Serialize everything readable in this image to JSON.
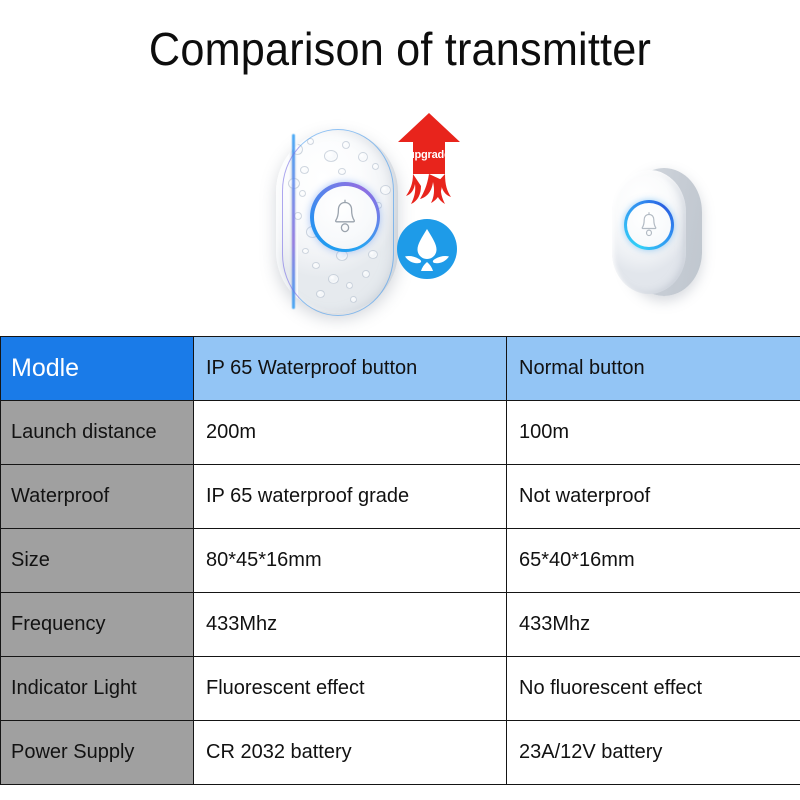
{
  "page": {
    "title": "Comparison of transmitter",
    "background_color": "#ffffff"
  },
  "hero": {
    "waterproof_device": {
      "name": "IP 65 Waterproof button",
      "icon": "doorbell-waterproof-transmitter",
      "ring_icon": "bell-icon",
      "has_water_droplets": true,
      "ring_gradient_from": "#1f9bf0",
      "ring_gradient_to": "#8f6ee2"
    },
    "normal_device": {
      "name": "Normal button",
      "icon": "doorbell-normal-transmitter",
      "ring_icon": "bell-icon",
      "ring_gradient_from": "#34cdf7",
      "ring_gradient_to": "#2a5fe0"
    },
    "upgrade_badge": {
      "label": "upgrade",
      "icon": "upward-arrow-flame-icon",
      "color": "#E8241C"
    },
    "waterproof_badge": {
      "icon": "water-drop-icon",
      "color": "#1E9BE8",
      "drop_color": "#ffffff"
    }
  },
  "table": {
    "header": {
      "label": "Modle",
      "columns": [
        "IP 65 Waterproof button",
        "Normal button"
      ],
      "label_bg": "#1A7BE8",
      "label_color": "#ffffff",
      "column_bg": "#93C5F5"
    },
    "label_column_bg": "#A0A0A0",
    "rows": [
      {
        "label": "Launch distance",
        "waterproof": "200m",
        "normal": "100m"
      },
      {
        "label": "Waterproof",
        "waterproof": "IP 65 waterproof grade",
        "normal": "Not waterproof"
      },
      {
        "label": "Size",
        "waterproof": "80*45*16mm",
        "normal": "65*40*16mm"
      },
      {
        "label": "Frequency",
        "waterproof": "433Mhz",
        "normal": "433Mhz"
      },
      {
        "label": "Indicator Light",
        "waterproof": "Fluorescent effect",
        "normal": "No fluorescent effect"
      },
      {
        "label": "Power Supply",
        "waterproof": "CR 2032 battery",
        "normal": "23A/12V battery"
      }
    ]
  }
}
